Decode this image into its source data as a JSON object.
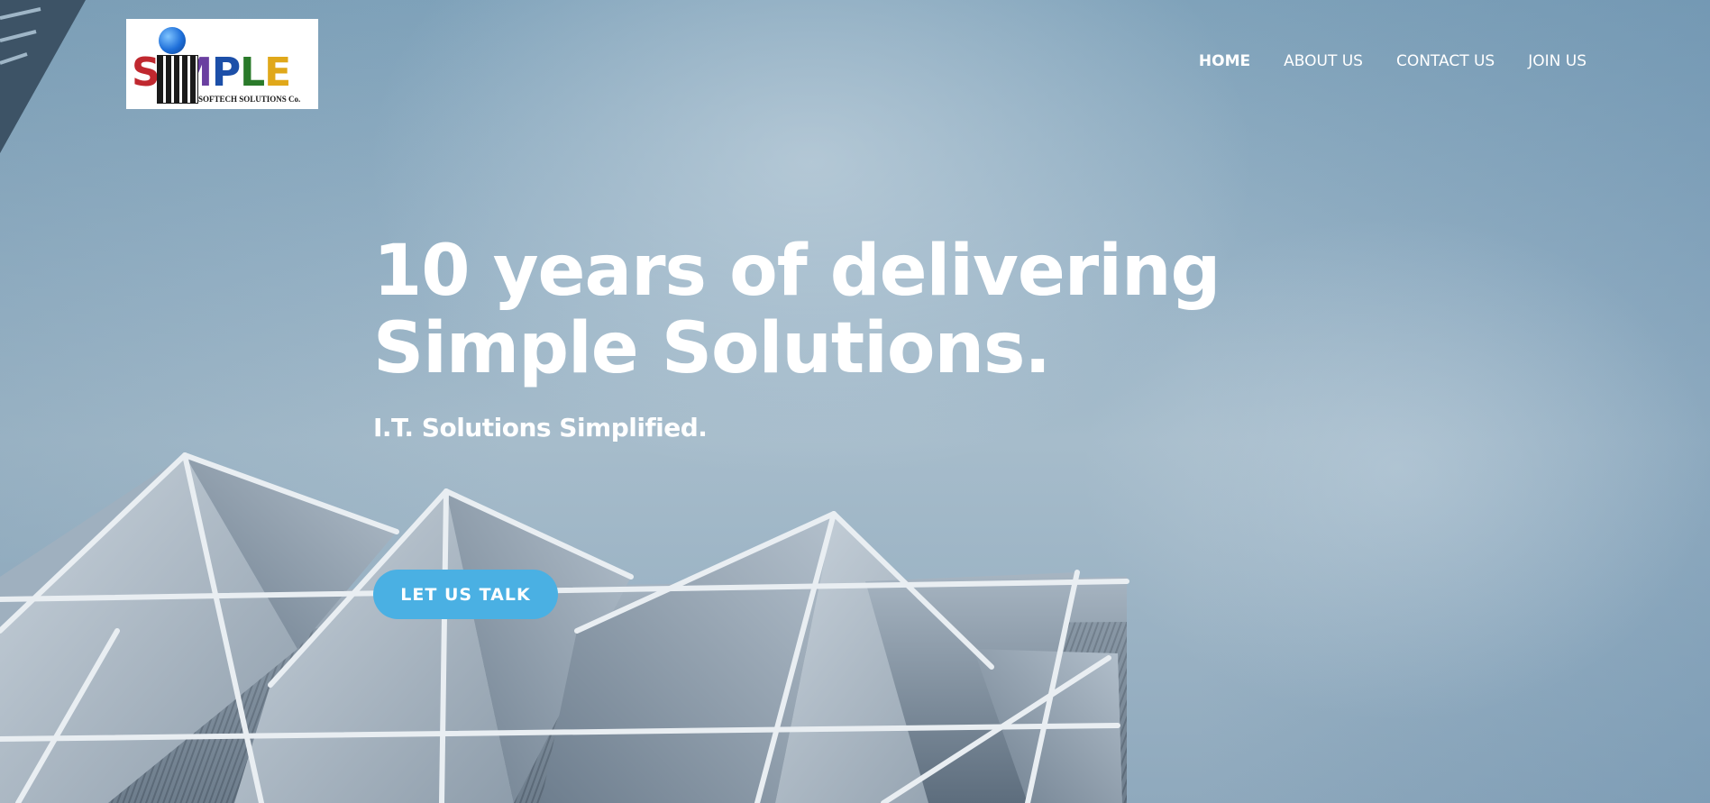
{
  "header": {
    "logo": {
      "word": [
        "S",
        "I",
        "M",
        "P",
        "L",
        "E"
      ],
      "tagline": "SOFTECH SOLUTIONS Co."
    },
    "nav": {
      "items": [
        {
          "label": "HOME",
          "active": true
        },
        {
          "label": "ABOUT US",
          "active": false
        },
        {
          "label": "CONTACT US",
          "active": false
        },
        {
          "label": "JOIN US",
          "active": false
        }
      ]
    }
  },
  "hero": {
    "headline_line1": "10 years of delivering",
    "headline_line2": "Simple Solutions.",
    "subheadline": "I.T. Solutions Simplified.",
    "cta_label": "LET US TALK",
    "background_image": "architectural-building-against-sky"
  },
  "colors": {
    "cta_background": "#4ab0e3",
    "nav_text": "#ffffff",
    "headline_text": "#ffffff"
  }
}
